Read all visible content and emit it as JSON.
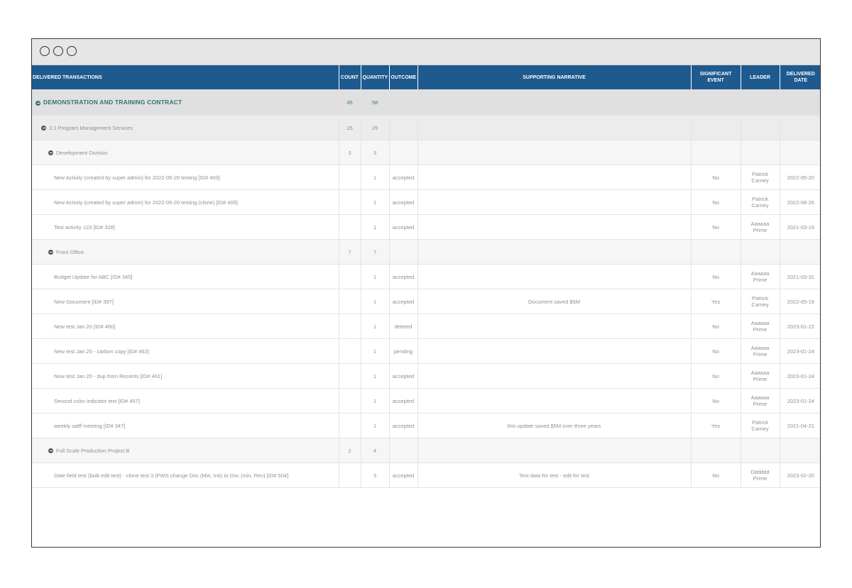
{
  "header": {
    "col_transactions": "DELIVERED TRANSACTIONS",
    "col_count": "COUNT",
    "col_quantity": "QUANTITY",
    "col_outcome": "OUTCOME",
    "col_narrative": "SUPPORTING NARRATIVE",
    "col_significant": "SIGNIFICANT EVENT",
    "col_leader": "LEADER",
    "col_date": "DELIVERED DATE"
  },
  "contract": {
    "name": "DEMONSTRATION AND TRAINING CONTRACT",
    "count": "45",
    "quantity": "58"
  },
  "service": {
    "name": "3.1 Program Management Services",
    "count": "25",
    "quantity": "29"
  },
  "divisions": [
    {
      "name": "Development Division",
      "count": "3",
      "quantity": "3",
      "rows": [
        {
          "title": "New Activity (created by super admin) for 2022-05-20 testing [ID# 403]",
          "quantity": "1",
          "outcome": "accepted",
          "narrative": "",
          "significant": "No",
          "leader": "Patrick Carney",
          "date": "2022-05-20"
        },
        {
          "title": "New Activity (created by super admin) for 2022-05-20 testing (clone) [ID# 405]",
          "quantity": "1",
          "outcome": "accepted",
          "narrative": "",
          "significant": "No",
          "leader": "Patrick Carney",
          "date": "2022-08-26"
        },
        {
          "title": "Test activity 123 [ID# 328]",
          "quantity": "1",
          "outcome": "accepted",
          "narrative": "",
          "significant": "No",
          "leader": "Aaaaaa Prime",
          "date": "2021-03-19"
        }
      ]
    },
    {
      "name": "Front Office",
      "count": "7",
      "quantity": "7",
      "rows": [
        {
          "title": "Budget Update for ABC [ID# 345]",
          "quantity": "1",
          "outcome": "accepted",
          "narrative": "",
          "significant": "No",
          "leader": "Aaaaaa Prime",
          "date": "2021-03-31"
        },
        {
          "title": "New Document [ID# 397]",
          "quantity": "1",
          "outcome": "accepted",
          "narrative": "Document saved $5M",
          "significant": "Yes",
          "leader": "Patrick Carney",
          "date": "2022-05-19"
        },
        {
          "title": "New test Jan 20 [ID# 460]",
          "quantity": "1",
          "outcome": "deleted",
          "narrative": "",
          "significant": "No",
          "leader": "Aaaaaa Prime",
          "date": "2023-01-22"
        },
        {
          "title": "New test Jan 20 - carbon copy [ID# 462]",
          "quantity": "1",
          "outcome": "pending",
          "narrative": "",
          "significant": "No",
          "leader": "Aaaaaa Prime",
          "date": "2023-01-24"
        },
        {
          "title": "New test Jan 20 - dup from Recents [ID# 461]",
          "quantity": "1",
          "outcome": "accepted",
          "narrative": "",
          "significant": "No",
          "leader": "Aaaaaa Prime",
          "date": "2023-01-24"
        },
        {
          "title": "Second color indicator test [ID# 457]",
          "quantity": "1",
          "outcome": "accepted",
          "narrative": "",
          "significant": "No",
          "leader": "Aaaaaa Prime",
          "date": "2023-01-24"
        },
        {
          "title": "weekly satff meeting [ID# 347]",
          "quantity": "1",
          "outcome": "accepted",
          "narrative": "this update saved $5M over three years",
          "significant": "Yes",
          "leader": "Patrick Carney",
          "date": "2021-04-21"
        }
      ]
    },
    {
      "name": "Full Scale Production Project B",
      "count": "2",
      "quantity": "4",
      "rows": [
        {
          "title": "Date field test (bulk edit test) - clone test 3 (PWS change Doc (Min, Init) to Doc (min, Rev) [ID# 504]",
          "quantity": "3",
          "outcome": "accepted",
          "narrative": "Test data for test - edit for test",
          "significant": "No",
          "leader": "Dddddd Prime",
          "date": "2023-02-20"
        }
      ]
    }
  ],
  "icons": {
    "window_controls": "circle-outline-icon",
    "toggle": "minus-circle-icon"
  },
  "colors": {
    "header_bg": "#1e5a8e",
    "contract_text": "#2f7470"
  }
}
